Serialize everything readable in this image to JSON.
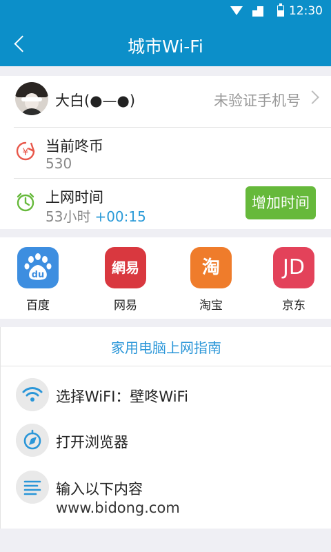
{
  "status_bar": {
    "time": "12:30",
    "icons": [
      "wifi-icon",
      "signal-icon",
      "battery-icon"
    ]
  },
  "header": {
    "title": "城市Wi-Fi",
    "back_icon": "chevron-left-icon"
  },
  "user": {
    "name": "大白(●—●)",
    "verify_text": "未验证手机号"
  },
  "coins": {
    "label": "当前咚币",
    "value": "530"
  },
  "online_time": {
    "label": "上网时间",
    "value": "53小时",
    "extra": "+00:15",
    "button_label": "增加时间"
  },
  "apps": [
    {
      "label": "百度",
      "icon_text": "du",
      "icon": "baidu-paw-icon",
      "color": "#3d8ee0"
    },
    {
      "label": "网易",
      "icon_text": "網易",
      "icon": "netease-icon",
      "color": "#d9383f"
    },
    {
      "label": "淘宝",
      "icon_text": "淘",
      "icon": "taobao-icon",
      "color": "#ef7c2b"
    },
    {
      "label": "京东",
      "icon_text": "JD",
      "icon": "jd-icon",
      "color": "#e3425a"
    }
  ],
  "guide": {
    "title": "家用电脑上网指南",
    "steps": [
      {
        "text": "选择WiFI：壁咚WiFi",
        "icon": "wifi-icon"
      },
      {
        "text": "打开浏览器",
        "icon": "compass-icon"
      },
      {
        "text": "输入以下内容",
        "icon": "text-lines-icon"
      }
    ],
    "url": "www.bidong.com"
  },
  "colors": {
    "primary": "#0c8fc9",
    "green_button": "#66b93b",
    "link_blue": "#2a96d8",
    "coin_red": "#e8574a",
    "clock_green": "#66b93b"
  }
}
